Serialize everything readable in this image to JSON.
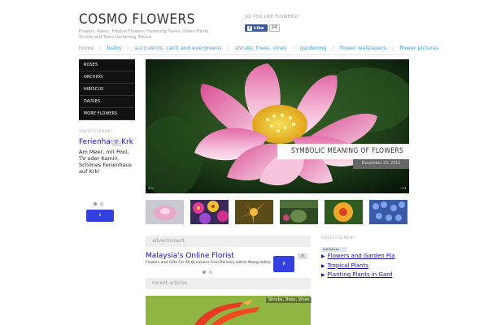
{
  "header": {
    "logo": "COSMO FLOWERS",
    "tagline": "Flowers, Roses, Tropical Flowers, Flowering Plants, Green Plants, Shrubs and Trees Gardening Advice",
    "like_question": "DO YOU LIKE FLOWERS?",
    "fb_like_label": "Like",
    "fb_count": "24"
  },
  "nav": {
    "items": [
      "home",
      "bulbs",
      "succulents, cacti and evergreens",
      "shrubs, trees, vines",
      "gardening",
      "flower wallpapers",
      "flower pictures"
    ]
  },
  "sidebar": {
    "menu": [
      "ROSES",
      "ORCHIDS",
      "HIBISCUS",
      "DAISIES",
      "MORE FLOWERS"
    ],
    "ad_label": "ADVERTISEMENT",
    "ad_title": "Ferienhaus Krk",
    "ad_text": "Am Meer, mit Pool, TV oder Kamin. Schönes Ferienhaus auf Krk!",
    "ad_button": "›",
    "ad_close": "X"
  },
  "slider": {
    "caption": "SYMBOLIC MEANING OF FLOWERS",
    "date": "December 23, 2011",
    "prev": "⟵",
    "next": "⟶"
  },
  "advert_section": {
    "title": "advertisment",
    "ad_title": "Malaysia's Online Florist",
    "ad_text": "Flowers and Gifts For All Occasions Free Delivery within Klang Valley",
    "ad_button": "›"
  },
  "recent": {
    "title": "recent articles",
    "category": "Shrubs, Trees, Vines"
  },
  "right_ad": {
    "label": "ADVERTISEMENT",
    "adchoices": "AdChoices",
    "links": [
      "Flowers and Garden Pla",
      "Tropical Plants",
      "Planting Plants in Gard"
    ]
  },
  "colors": {
    "accent_nav": "#4a9bc8",
    "ad_button": "#3340e0",
    "sidemenu_bg": "#111111"
  }
}
